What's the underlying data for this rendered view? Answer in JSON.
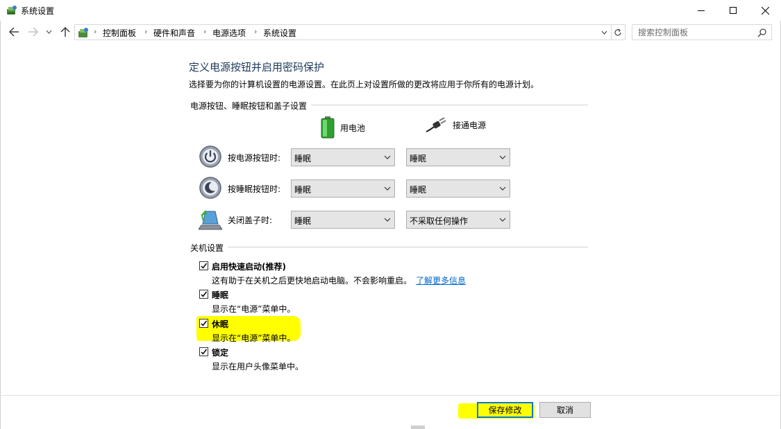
{
  "window": {
    "title": "系统设置",
    "icon": "control-panel-icon",
    "minimize_icon": "minimize-icon",
    "maximize_icon": "maximize-icon",
    "close_icon": "close-icon"
  },
  "nav": {
    "back_icon": "back-arrow-icon",
    "forward_icon": "forward-arrow-icon",
    "recent_icon": "chevron-down-icon",
    "up_icon": "up-arrow-icon",
    "breadcrumb": [
      "控制面板",
      "硬件和声音",
      "电源选项",
      "系统设置"
    ],
    "refresh_icon": "refresh-icon",
    "search_placeholder": "搜索控制面板"
  },
  "main": {
    "title": "定义电源按钮并启用密码保护",
    "description": "选择要为你的计算机设置的电源设置。在此页上对设置所做的更改将应用于你所有的电源计划。",
    "power_section": {
      "header": "电源按钮、睡眠按钮和盖子设置",
      "columns": [
        {
          "label": "用电池",
          "icon": "battery-icon"
        },
        {
          "label": "接通电源",
          "icon": "power-plug-icon"
        }
      ],
      "rows": [
        {
          "label": "按电源按钮时:",
          "icon": "power-button-icon",
          "battery": "睡眠",
          "plugged": "睡眠"
        },
        {
          "label": "按睡眠按钮时:",
          "icon": "sleep-button-icon",
          "battery": "睡眠",
          "plugged": "睡眠"
        },
        {
          "label": "关闭盖子时:",
          "icon": "laptop-lid-icon",
          "battery": "睡眠",
          "plugged": "不采取任何操作"
        }
      ]
    },
    "shutdown_section": {
      "header": "关机设置",
      "items": [
        {
          "label": "启用快速启动(推荐)",
          "checked": true,
          "desc": "这有助于在关机之后更快地启动电脑。不会影响重启。",
          "link": "了解更多信息"
        },
        {
          "label": "睡眠",
          "checked": true,
          "desc": "显示在“电源”菜单中。"
        },
        {
          "label": "休眠",
          "checked": true,
          "desc": "显示在“电源”菜单中。",
          "highlighted": true
        },
        {
          "label": "锁定",
          "checked": true,
          "desc": "显示在用户头像菜单中。"
        }
      ]
    }
  },
  "footer": {
    "save_label": "保存修改",
    "cancel_label": "取消"
  },
  "colors": {
    "title_blue": "#1e395b",
    "link_blue": "#0066cc",
    "highlight": "#ffff00",
    "accent": "#0078d7"
  }
}
